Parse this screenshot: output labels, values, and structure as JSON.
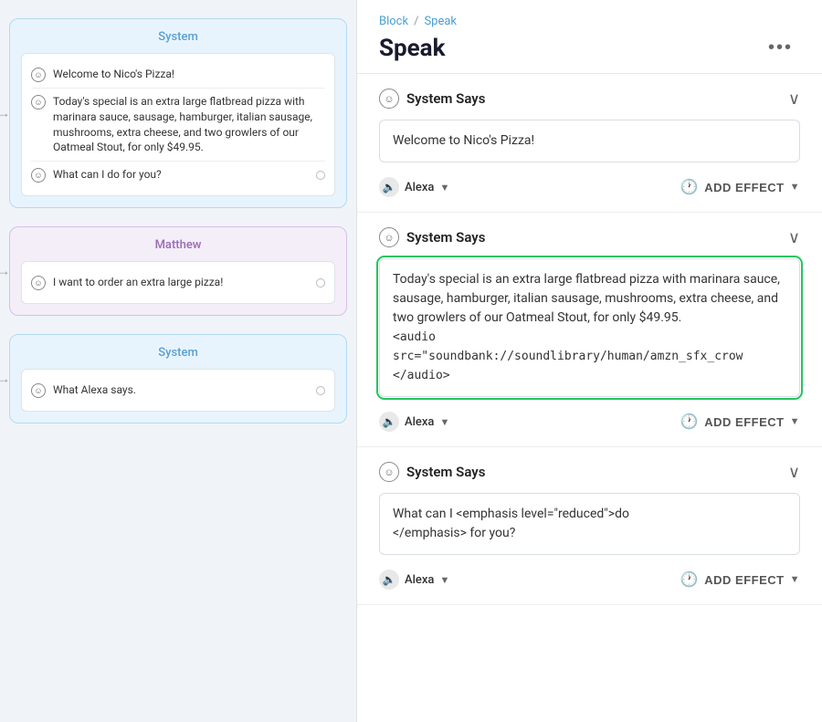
{
  "breadcrumb": {
    "link_label": "Block",
    "separator": "/",
    "current": "Speak"
  },
  "page_title": "Speak",
  "more_icon": "•••",
  "sections": [
    {
      "id": "section-1",
      "title": "System Says",
      "text": "Welcome to Nico's Pizza!",
      "highlighted": false,
      "audio_tag": null,
      "voice": "Alexa",
      "add_effect_label": "ADD EFFECT"
    },
    {
      "id": "section-2",
      "title": "System Says",
      "text": "Today's special is an extra large flatbread pizza with marinara sauce, sausage, hamburger, italian sausage, mushrooms,  extra cheese, and two growlers of our Oatmeal Stout, for only $49.95.",
      "highlighted": true,
      "audio_tag": "<audio\nsrc=\"soundbank://soundlibrary/human/amzn_sfx_crow\n</audio>",
      "voice": "Alexa",
      "add_effect_label": "ADD EFFECT"
    },
    {
      "id": "section-3",
      "title": "System Says",
      "text": "What can I <emphasis level=\"reduced\">do\n</emphasis> for you?",
      "highlighted": false,
      "audio_tag": null,
      "voice": "Alexa",
      "add_effect_label": "ADD EFFECT"
    }
  ],
  "left_nodes": [
    {
      "id": "node-1",
      "type": "system",
      "title": "System",
      "items": [
        {
          "text": "Welcome to Nico's Pizza!",
          "has_dot": false
        },
        {
          "text": "Today's special is an extra large flatbread pizza with marinara sauce, sausage, hamburger, italian sausage, mushrooms, extra cheese, and two growlers of our Oatmeal Stout, for only $49.95.",
          "has_dot": false
        },
        {
          "text": "What can I do for you?",
          "has_dot": true
        }
      ]
    },
    {
      "id": "node-2",
      "type": "user",
      "title": "Matthew",
      "items": [
        {
          "text": "I want to order an extra large pizza!",
          "has_dot": true
        }
      ]
    },
    {
      "id": "node-3",
      "type": "system",
      "title": "System",
      "items": [
        {
          "text": "What Alexa says.",
          "has_dot": true
        }
      ]
    }
  ]
}
